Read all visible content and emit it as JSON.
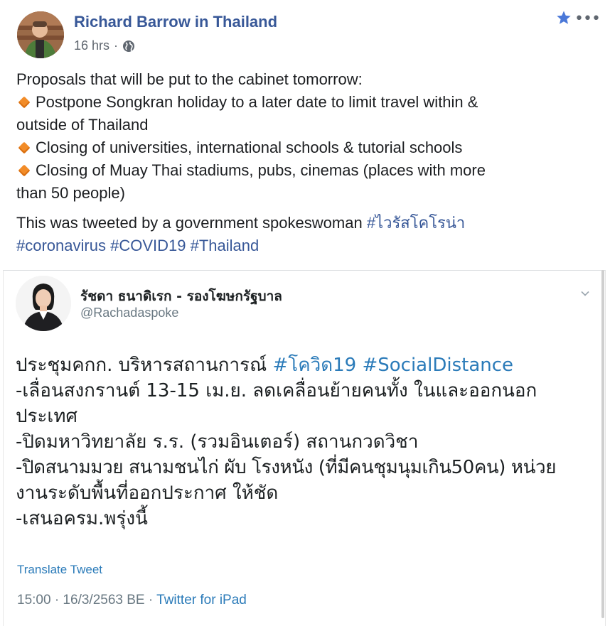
{
  "post": {
    "author": "Richard Barrow in Thailand",
    "time": "16 hrs",
    "time_separator": "·",
    "privacy_icon": "globe-icon",
    "more_icon": "ellipsis-icon",
    "favorite_icon": "star-icon",
    "intro": "Proposals that will be put to the cabinet tomorrow:",
    "bullets": [
      {
        "line1": "Postpone Songkran holiday to a later date to limit travel within &",
        "line2": "outside of Thailand"
      },
      {
        "line1": "Closing of universities, international schools & tutorial schools",
        "line2": ""
      },
      {
        "line1": "Closing of Muay Thai stadiums, pubs, cinemas (places with more",
        "line2": "than 50 people)"
      }
    ],
    "closing_text": "This was tweeted by a government spokeswoman ",
    "hashtags": [
      "#ไวรัสโคโรน่า",
      "#coronavirus",
      "#COVID19",
      "#Thailand"
    ]
  },
  "tweet": {
    "name": "รัชดา ธนาดิเรก - รองโฆษกรัฐบาล",
    "handle": "@Rachadaspoke",
    "line1_text": "ประชุมคกก. บริหารสถานการณ์ ",
    "line1_tags": [
      "#โควิด19",
      "#SocialDistance"
    ],
    "lines": [
      "-เลื่อนสงกรานต์ 13-15 เม.ย. ลดเคลื่อนย้ายคนทั้ง ในและออกนอก",
      "ประเทศ",
      "-ปิดมหาวิทยาลัย ร.ร. (รวมอินเตอร์) สถานกวดวิชา",
      "-ปิดสนามมวย สนามชนไก่ ผับ โรงหนัง (ที่มีคนชุมนุมเกิน50คน) หน่วย",
      "งานระดับพื้นที่ออกประกาศ ให้ชัด",
      "-เสนอครม.พรุ่งนี้"
    ],
    "translate_label": "Translate Tweet",
    "timestamp": "15:00 · 16/3/2563 BE",
    "separator": " · ",
    "source": "Twitter for iPad"
  },
  "colors": {
    "facebook_blue": "#385898",
    "twitter_blue": "#2b7bb9",
    "bullet_orange": "#f28c28"
  }
}
